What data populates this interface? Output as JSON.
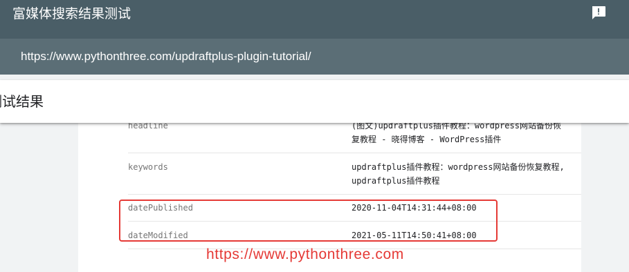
{
  "app": {
    "title": "富媒体搜索结果测试",
    "feedback_icon": "feedback-icon"
  },
  "url_bar": {
    "url": "https://www.pythonthree.com/updraftplus-plugin-tutorial/"
  },
  "results": {
    "heading": "测试结果"
  },
  "properties": [
    {
      "key": "headline",
      "value": "(图文)updraftplus插件教程：wordpress网站备份恢复教程 - 晓得博客 - WordPress插件"
    },
    {
      "key": "keywords",
      "value": "updraftplus插件教程：wordpress网站备份恢复教程,updraftplus插件教程"
    },
    {
      "key": "datePublished",
      "value": "2020-11-04T14:31:44+08:00"
    },
    {
      "key": "dateModified",
      "value": "2021-05-11T14:50:41+08:00"
    }
  ],
  "colors": {
    "header_bg": "#4a5e67",
    "url_strip_bg": "#5b6e76",
    "highlight": "#e53935"
  },
  "watermark": {
    "text": "https://www.pythonthree.com"
  }
}
